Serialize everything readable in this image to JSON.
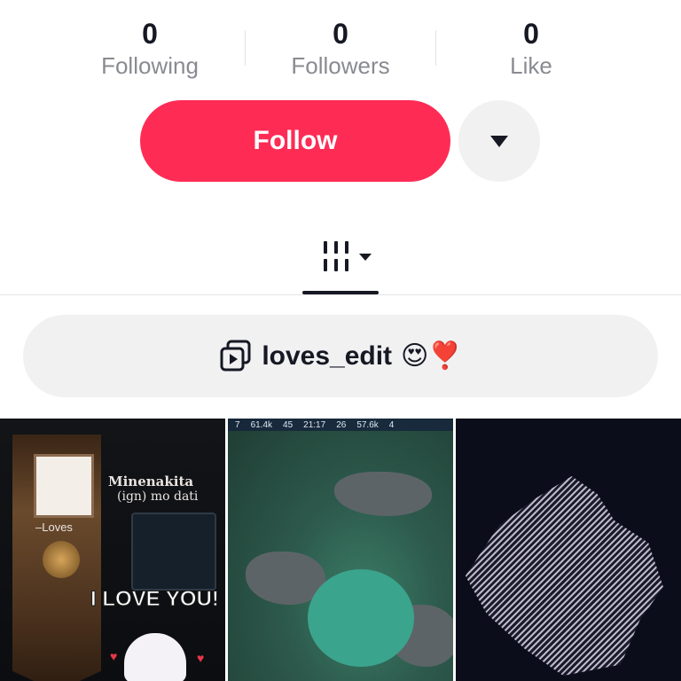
{
  "stats": [
    {
      "value": "0",
      "label": "Following"
    },
    {
      "value": "0",
      "label": "Followers"
    },
    {
      "value": "0",
      "label": "Like"
    }
  ],
  "actions": {
    "follow_label": "Follow",
    "more_icon": "caret-down-icon"
  },
  "tabs": {
    "videos_icon": "grid-icon",
    "dropdown_icon": "caret-down-icon"
  },
  "playlist": {
    "icon": "playlist-icon",
    "label": "loves_edit",
    "emojis": "😍❣️"
  },
  "thumbnails": [
    {
      "overlay": {
        "name": "Minenakita",
        "ign": "(ign) mo dati",
        "tag": "–Loves",
        "caption": "I LOVE YOU!"
      }
    },
    {
      "hud": {
        "kills": "7",
        "gold_left": "61.4k",
        "score": "45",
        "time": "21:17",
        "score2": "26",
        "gold_right": "57.6k",
        "count": "4"
      }
    },
    {}
  ],
  "colors": {
    "accent": "#fe2c55",
    "text": "#161823",
    "muted": "#8a8b91",
    "chip_bg": "#f1f1f2"
  }
}
